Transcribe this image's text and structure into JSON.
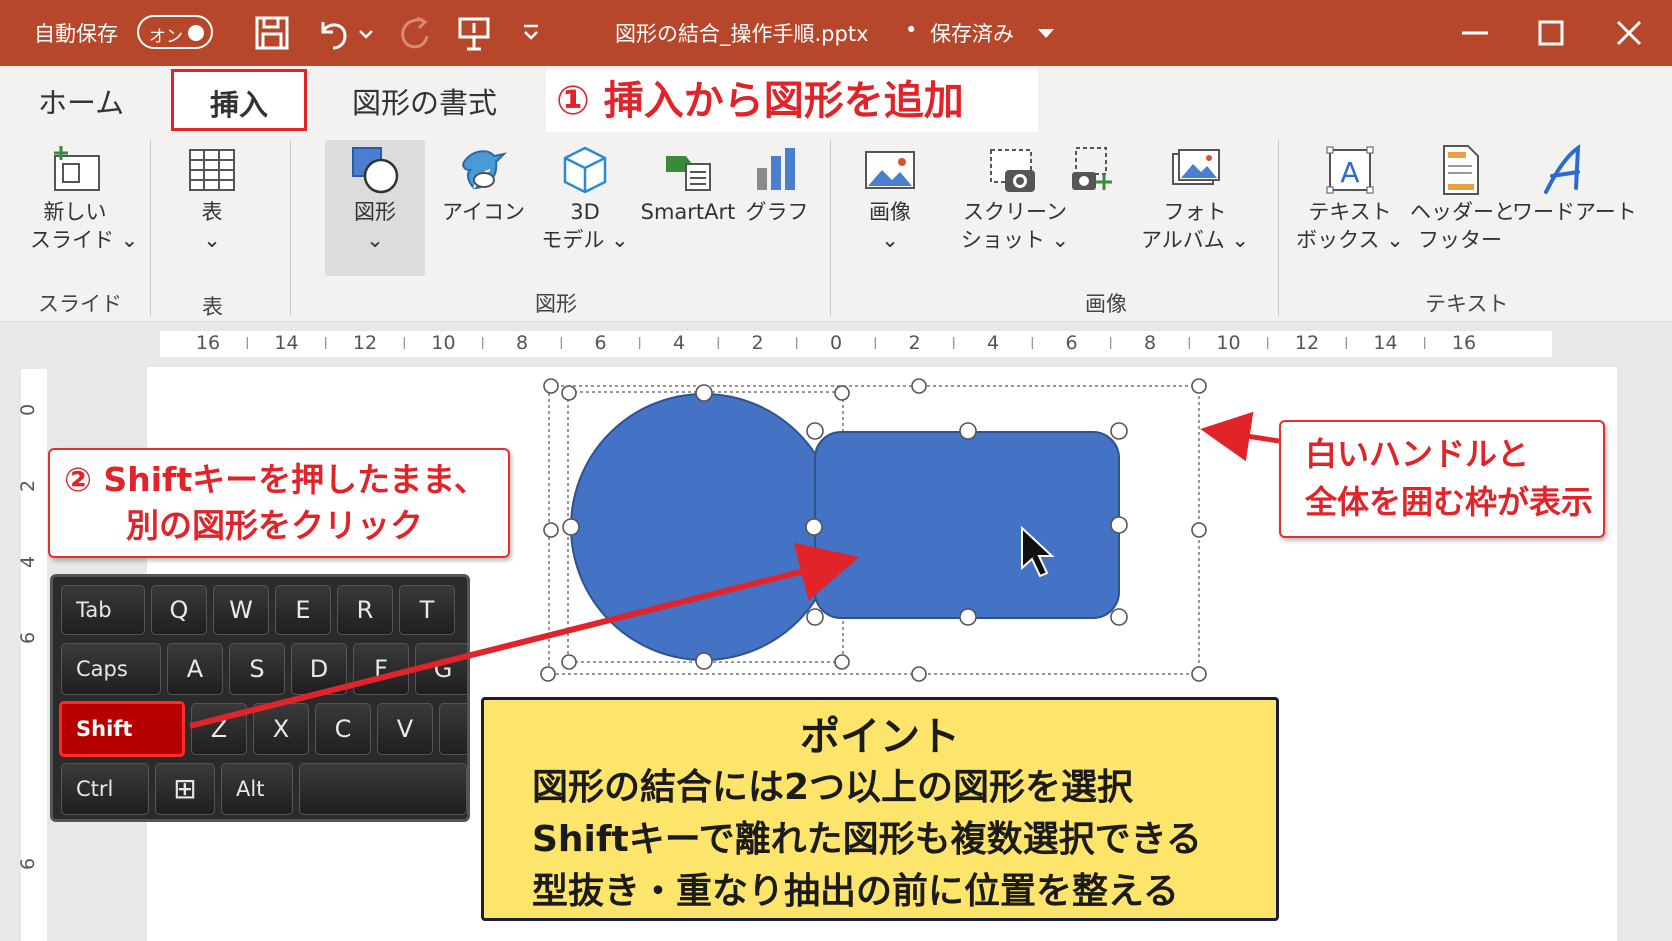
{
  "titlebar": {
    "autosave_label": "自動保存",
    "toggle_label": "オン",
    "file_title": "図形の結合_操作手順.pptx",
    "separator": "•",
    "save_status": "保存済み"
  },
  "tabs": {
    "home": "ホーム",
    "insert": "挿入",
    "shape_format": "図形の書式"
  },
  "step1_callout": "① 挿入から図形を追加",
  "ribbon": {
    "new_slide": [
      "新しい",
      "スライド ⌄"
    ],
    "table": [
      "表",
      "⌄"
    ],
    "shape": [
      "図形",
      "⌄"
    ],
    "icon": [
      "アイコン"
    ],
    "model3d": [
      "3D",
      "モデル ⌄"
    ],
    "smartart": [
      "SmartArt"
    ],
    "chart": [
      "グラフ"
    ],
    "image": [
      "画像",
      "⌄"
    ],
    "screenshot": [
      "スクリーン",
      "ショット ⌄"
    ],
    "photo_album": [
      "フォト",
      "アルバム ⌄"
    ],
    "textbox": [
      "テキスト",
      "ボックス ⌄"
    ],
    "header_footer": [
      "ヘッダーと",
      "フッター"
    ],
    "wordart": [
      "ワードアート"
    ],
    "groups": {
      "slides": "スライド",
      "tables": "表",
      "illustrations": "図形",
      "images": "画像",
      "text": "テキスト"
    }
  },
  "ruler": {
    "h_labels": [
      "16",
      "14",
      "12",
      "10",
      "8",
      "6",
      "4",
      "2",
      "0",
      "2",
      "4",
      "6",
      "8",
      "10",
      "12",
      "14",
      "16"
    ],
    "v_labels": [
      "0",
      "2",
      "4",
      "6",
      "6"
    ]
  },
  "step2_callout": [
    "② Shiftキーを押したまま、",
    "別の図形をクリック"
  ],
  "right_callout": [
    "白いハンドルと",
    "全体を囲む枠が表示"
  ],
  "keyboard": {
    "row1": [
      "Tab",
      "Q",
      "W",
      "E",
      "R",
      "T"
    ],
    "row2": [
      "Caps",
      "A",
      "S",
      "D",
      "F",
      "G"
    ],
    "row3": [
      "Shift",
      "Z",
      "X",
      "C",
      "V"
    ],
    "row4": [
      "Ctrl",
      "⊞",
      "Alt"
    ]
  },
  "point": {
    "title": "ポイント",
    "lines": [
      "図形の結合には2つ以上の図形を選択",
      "Shiftキーで離れた図形も複数選択できる",
      "型抜き・重なり抽出の前に位置を整える"
    ]
  },
  "colors": {
    "titlebar": "#b7472a",
    "accent_red": "#e0242a",
    "shape_fill": "#4472c4",
    "point_bg": "#fde46a"
  },
  "icons": [
    "save-icon",
    "undo-icon",
    "redo-icon",
    "presenter-icon",
    "customize-icon",
    "minimize-icon",
    "maximize-icon",
    "close-icon",
    "mouse-cursor-icon"
  ]
}
